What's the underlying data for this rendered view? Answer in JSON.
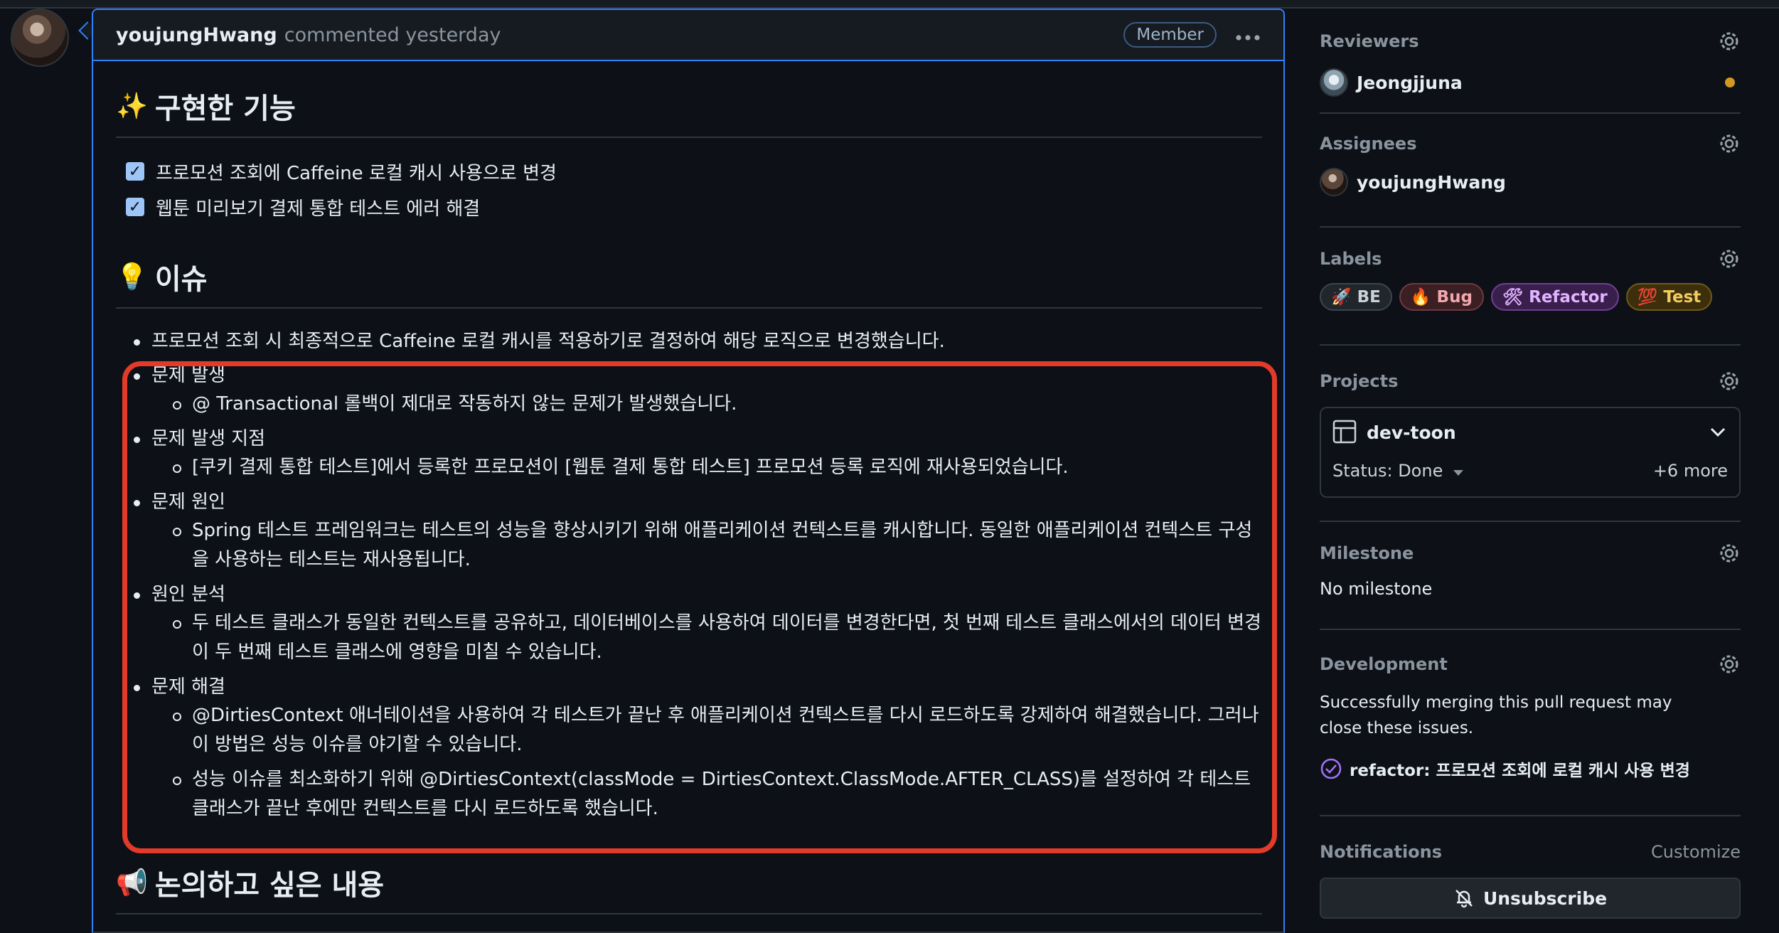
{
  "comment": {
    "author": "youjungHwang",
    "action": "commented yesterday",
    "badge": "Member",
    "more_icon": "kebab-horizontal-icon"
  },
  "features": {
    "emoji": "✨",
    "title": "구현한 기능",
    "tasks": [
      "프로모션 조회에 Caffeine 로컬 캐시 사용으로 변경",
      "웹툰 미리보기 결제 통합 테스트 에러 해결"
    ]
  },
  "issues": {
    "emoji": "💡",
    "title": "이슈",
    "intro": "프로모션 조회 시 최종적으로 Caffeine 로컬 캐시를 적용하기로 결정하여 해당 로직으로 변경했습니다.",
    "items": [
      {
        "label": "문제 발생",
        "subs": [
          "@ Transactional 롤백이 제대로 작동하지 않는 문제가 발생했습니다."
        ]
      },
      {
        "label": "문제 발생 지점",
        "subs": [
          "[쿠키 결제 통합 테스트]에서 등록한 프로모션이 [웹툰 결제 통합 테스트] 프로모션 등록 로직에 재사용되었습니다."
        ]
      },
      {
        "label": "문제 원인",
        "subs": [
          "Spring 테스트 프레임워크는 테스트의 성능을 향상시키기 위해 애플리케이션 컨텍스트를 캐시합니다. 동일한 애플리케이션 컨텍스트 구성을 사용하는 테스트는 재사용됩니다."
        ]
      },
      {
        "label": "원인 분석",
        "subs": [
          "두 테스트 클래스가 동일한 컨텍스트를 공유하고, 데이터베이스를 사용하여 데이터를 변경한다면, 첫 번째 테스트 클래스에서의 데이터 변경이 두 번째 테스트 클래스에 영향을 미칠 수 있습니다."
        ]
      },
      {
        "label": "문제 해결",
        "subs": [
          "@DirtiesContext 애너테이션을 사용하여 각 테스트가 끝난 후 애플리케이션 컨텍스트를 다시 로드하도록 강제하여 해결했습니다. 그러나 이 방법은 성능 이슈를 야기할 수 있습니다.",
          "성능 이슈를 최소화하기 위해 @DirtiesContext(classMode = DirtiesContext.ClassMode.AFTER_CLASS)를 설정하여 각 테스트 클래스가 끝난 후에만 컨텍스트를 다시 로드하도록 했습니다."
        ]
      }
    ]
  },
  "discussion": {
    "emoji": "📢",
    "title": "논의하고 싶은 내용"
  },
  "sidebar": {
    "reviewers": {
      "title": "Reviewers",
      "user": "Jeongjjuna",
      "status_color": "#d29922"
    },
    "assignees": {
      "title": "Assignees",
      "user": "youjungHwang"
    },
    "labels": {
      "title": "Labels",
      "items": [
        {
          "text": "🚀 BE",
          "bg": "#21262d",
          "border": "#3d444d",
          "color": "#c9d1d9"
        },
        {
          "text": "🔥 Bug",
          "bg": "#3c1f22",
          "border": "#6e3a3f",
          "color": "#f0a8ae"
        },
        {
          "text": "🛠 Refactor",
          "bg": "#3a1f4d",
          "border": "#6f3f8f",
          "color": "#e2b3ff"
        },
        {
          "text": "💯 Test",
          "bg": "#3d2f0c",
          "border": "#6e5a1c",
          "color": "#f2cc60"
        }
      ]
    },
    "projects": {
      "title": "Projects",
      "name": "dev-toon",
      "status": "Status: Done",
      "more": "+6 more"
    },
    "milestone": {
      "title": "Milestone",
      "value": "No milestone"
    },
    "development": {
      "title": "Development",
      "text": "Successfully merging this pull request may close these issues.",
      "link": "refactor: 프로모션 조회에 로컬 캐시 사용 변경"
    },
    "notifications": {
      "title": "Notifications",
      "customize": "Customize",
      "button": "Unsubscribe"
    }
  },
  "colors": {
    "accent": "#2f81f7",
    "highlight": "#e23b2a",
    "background": "#0d1117"
  }
}
